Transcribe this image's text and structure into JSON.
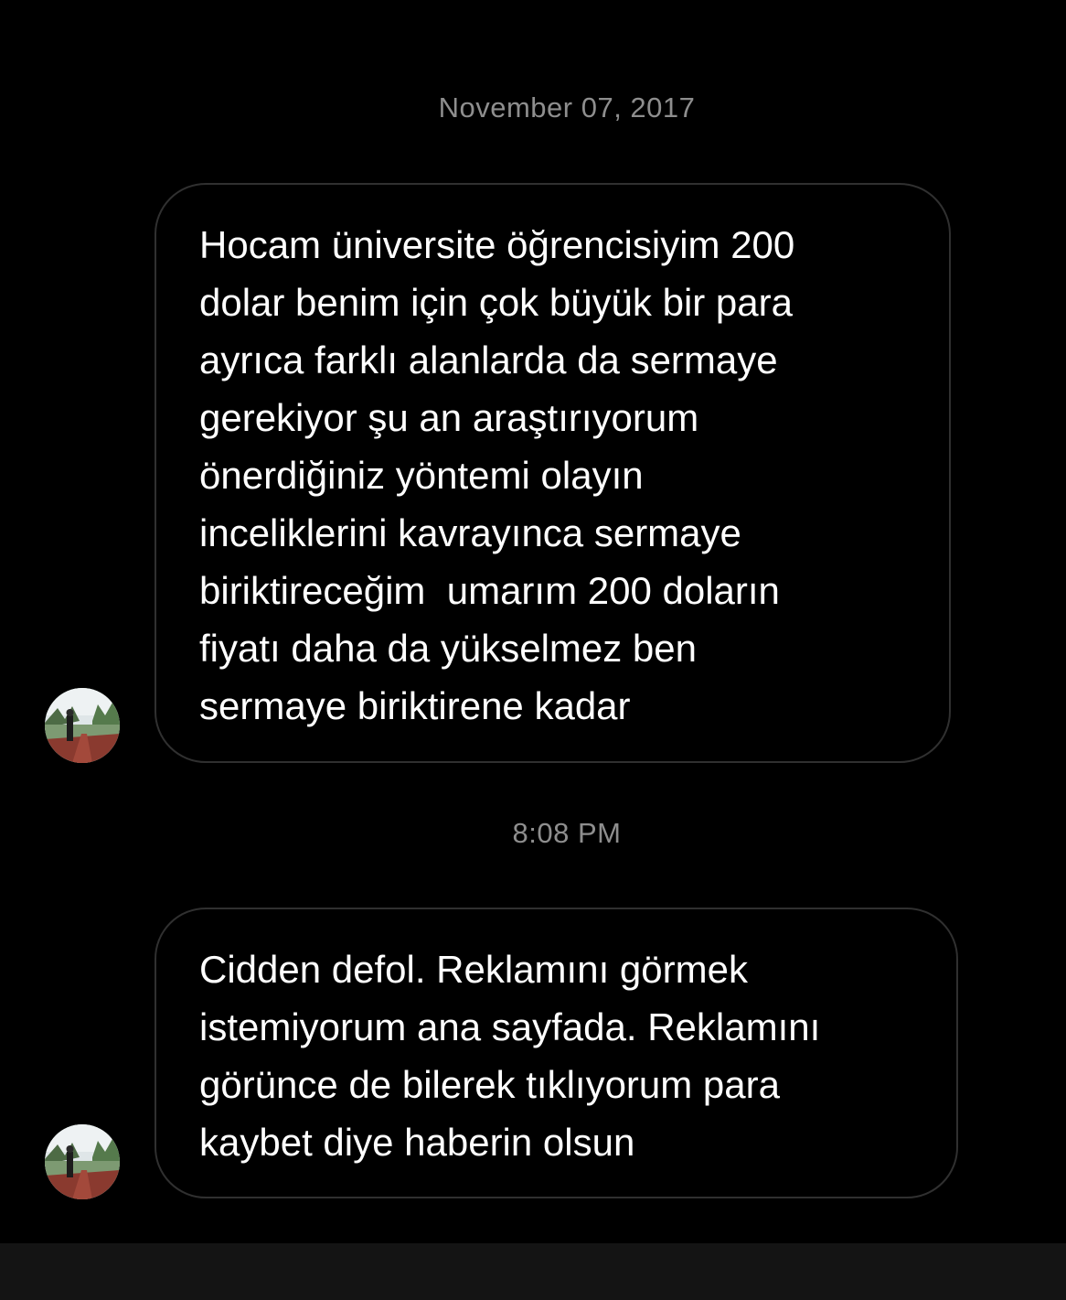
{
  "thread": {
    "date_separator": "November 07, 2017",
    "time_separator": "8:08 PM",
    "messages": [
      {
        "text": "Hocam üniversite öğrencisiyim 200\ndolar benim için çok büyük bir para\nayrıca farklı alanlarda da sermaye\ngerekiyor şu an araştırıyorum\nönerdiğiniz yöntemi olayın\ninceliklerini kavrayınca sermaye\nbiriktireceğim  umarım 200 doların\nfiyatı daha da yükselmez ben\nsermaye biriktirene kadar"
      },
      {
        "text": "Cidden defol. Reklamını görmek\nistemiyorum ana sayfada. Reklamını\ngörünce de bilerek tıklıyorum para\nkaybet diye haberin olsun"
      }
    ]
  },
  "colors": {
    "background": "#000000",
    "bubble_border": "#303030",
    "timestamp_text": "#8e8e8e",
    "message_text": "#ffffff",
    "bottom_bar": "#141414"
  },
  "icons": {
    "avatar": "profile-photo-avatar"
  }
}
